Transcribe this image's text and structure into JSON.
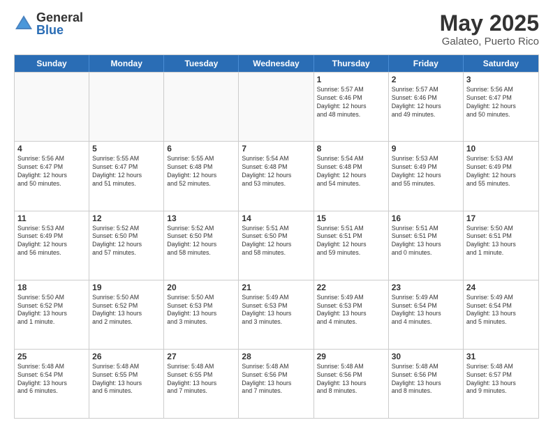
{
  "header": {
    "logo": {
      "general": "General",
      "blue": "Blue"
    },
    "title": "May 2025",
    "location": "Galateo, Puerto Rico"
  },
  "weekdays": [
    "Sunday",
    "Monday",
    "Tuesday",
    "Wednesday",
    "Thursday",
    "Friday",
    "Saturday"
  ],
  "rows": [
    [
      {
        "day": "",
        "info": ""
      },
      {
        "day": "",
        "info": ""
      },
      {
        "day": "",
        "info": ""
      },
      {
        "day": "",
        "info": ""
      },
      {
        "day": "1",
        "info": "Sunrise: 5:57 AM\nSunset: 6:46 PM\nDaylight: 12 hours\nand 48 minutes."
      },
      {
        "day": "2",
        "info": "Sunrise: 5:57 AM\nSunset: 6:46 PM\nDaylight: 12 hours\nand 49 minutes."
      },
      {
        "day": "3",
        "info": "Sunrise: 5:56 AM\nSunset: 6:47 PM\nDaylight: 12 hours\nand 50 minutes."
      }
    ],
    [
      {
        "day": "4",
        "info": "Sunrise: 5:56 AM\nSunset: 6:47 PM\nDaylight: 12 hours\nand 50 minutes."
      },
      {
        "day": "5",
        "info": "Sunrise: 5:55 AM\nSunset: 6:47 PM\nDaylight: 12 hours\nand 51 minutes."
      },
      {
        "day": "6",
        "info": "Sunrise: 5:55 AM\nSunset: 6:48 PM\nDaylight: 12 hours\nand 52 minutes."
      },
      {
        "day": "7",
        "info": "Sunrise: 5:54 AM\nSunset: 6:48 PM\nDaylight: 12 hours\nand 53 minutes."
      },
      {
        "day": "8",
        "info": "Sunrise: 5:54 AM\nSunset: 6:48 PM\nDaylight: 12 hours\nand 54 minutes."
      },
      {
        "day": "9",
        "info": "Sunrise: 5:53 AM\nSunset: 6:49 PM\nDaylight: 12 hours\nand 55 minutes."
      },
      {
        "day": "10",
        "info": "Sunrise: 5:53 AM\nSunset: 6:49 PM\nDaylight: 12 hours\nand 55 minutes."
      }
    ],
    [
      {
        "day": "11",
        "info": "Sunrise: 5:53 AM\nSunset: 6:49 PM\nDaylight: 12 hours\nand 56 minutes."
      },
      {
        "day": "12",
        "info": "Sunrise: 5:52 AM\nSunset: 6:50 PM\nDaylight: 12 hours\nand 57 minutes."
      },
      {
        "day": "13",
        "info": "Sunrise: 5:52 AM\nSunset: 6:50 PM\nDaylight: 12 hours\nand 58 minutes."
      },
      {
        "day": "14",
        "info": "Sunrise: 5:51 AM\nSunset: 6:50 PM\nDaylight: 12 hours\nand 58 minutes."
      },
      {
        "day": "15",
        "info": "Sunrise: 5:51 AM\nSunset: 6:51 PM\nDaylight: 12 hours\nand 59 minutes."
      },
      {
        "day": "16",
        "info": "Sunrise: 5:51 AM\nSunset: 6:51 PM\nDaylight: 13 hours\nand 0 minutes."
      },
      {
        "day": "17",
        "info": "Sunrise: 5:50 AM\nSunset: 6:51 PM\nDaylight: 13 hours\nand 1 minute."
      }
    ],
    [
      {
        "day": "18",
        "info": "Sunrise: 5:50 AM\nSunset: 6:52 PM\nDaylight: 13 hours\nand 1 minute."
      },
      {
        "day": "19",
        "info": "Sunrise: 5:50 AM\nSunset: 6:52 PM\nDaylight: 13 hours\nand 2 minutes."
      },
      {
        "day": "20",
        "info": "Sunrise: 5:50 AM\nSunset: 6:53 PM\nDaylight: 13 hours\nand 3 minutes."
      },
      {
        "day": "21",
        "info": "Sunrise: 5:49 AM\nSunset: 6:53 PM\nDaylight: 13 hours\nand 3 minutes."
      },
      {
        "day": "22",
        "info": "Sunrise: 5:49 AM\nSunset: 6:53 PM\nDaylight: 13 hours\nand 4 minutes."
      },
      {
        "day": "23",
        "info": "Sunrise: 5:49 AM\nSunset: 6:54 PM\nDaylight: 13 hours\nand 4 minutes."
      },
      {
        "day": "24",
        "info": "Sunrise: 5:49 AM\nSunset: 6:54 PM\nDaylight: 13 hours\nand 5 minutes."
      }
    ],
    [
      {
        "day": "25",
        "info": "Sunrise: 5:48 AM\nSunset: 6:54 PM\nDaylight: 13 hours\nand 6 minutes."
      },
      {
        "day": "26",
        "info": "Sunrise: 5:48 AM\nSunset: 6:55 PM\nDaylight: 13 hours\nand 6 minutes."
      },
      {
        "day": "27",
        "info": "Sunrise: 5:48 AM\nSunset: 6:55 PM\nDaylight: 13 hours\nand 7 minutes."
      },
      {
        "day": "28",
        "info": "Sunrise: 5:48 AM\nSunset: 6:56 PM\nDaylight: 13 hours\nand 7 minutes."
      },
      {
        "day": "29",
        "info": "Sunrise: 5:48 AM\nSunset: 6:56 PM\nDaylight: 13 hours\nand 8 minutes."
      },
      {
        "day": "30",
        "info": "Sunrise: 5:48 AM\nSunset: 6:56 PM\nDaylight: 13 hours\nand 8 minutes."
      },
      {
        "day": "31",
        "info": "Sunrise: 5:48 AM\nSunset: 6:57 PM\nDaylight: 13 hours\nand 9 minutes."
      }
    ]
  ]
}
